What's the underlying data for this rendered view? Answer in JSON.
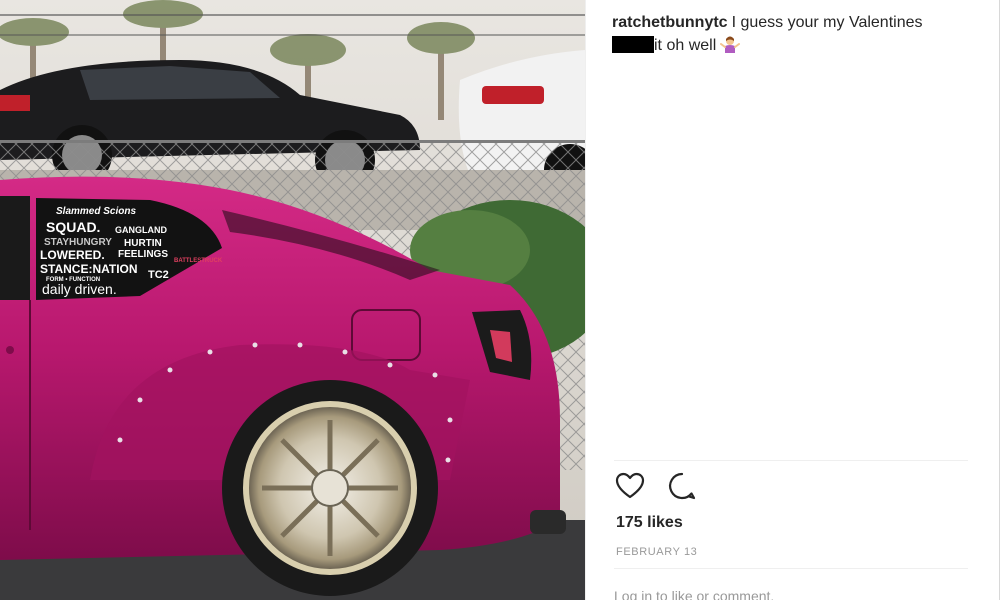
{
  "post": {
    "username": "ratchetbunnytc",
    "caption_part1": "I guess your my Valentines",
    "caption_part2": "it oh well",
    "emoji": "person-shrugging-icon",
    "likes": "175 likes",
    "date": "FEBRUARY 13",
    "comment_placeholder": "Log in to like or comment."
  },
  "photo": {
    "subject": "magenta-car-photo",
    "stickers": [
      "Slammed Scions",
      "SQUAD.",
      "STAYHUNGRY",
      "LOWERED.",
      "STANCE:NATION",
      "FORM • FUNCTION",
      "daily driven.",
      "GANGLAND",
      "HURTIN",
      "FEELINGS",
      "TC2",
      "BATTLESTRUCK"
    ]
  },
  "colors": {
    "text": "#262626",
    "muted": "#999999",
    "divider": "#efefef",
    "car_body": "#b8186e",
    "redaction": "#000000"
  }
}
